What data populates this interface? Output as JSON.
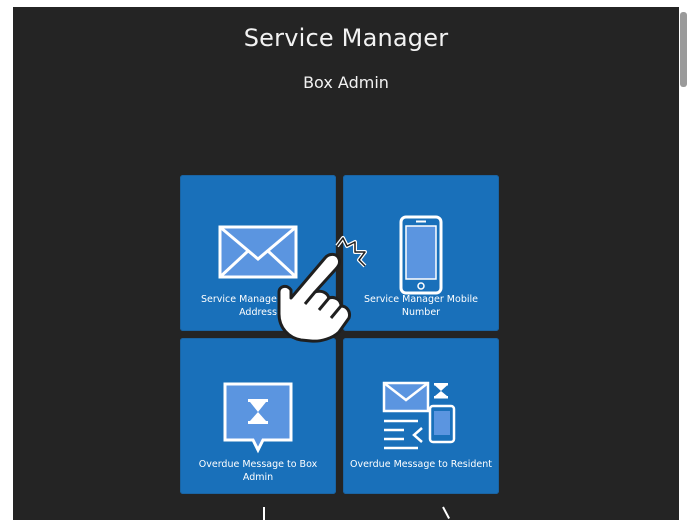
{
  "header": {
    "title": "Service Manager",
    "subtitle": "Box Admin"
  },
  "tiles": [
    {
      "label": "Service Manager Mobile Address",
      "icon": "envelope-icon"
    },
    {
      "label": "Service Manager Mobile Number",
      "icon": "mobile-phone-icon"
    },
    {
      "label": "Overdue Message to Box Admin",
      "icon": "hourglass-speech-bubble-icon"
    },
    {
      "label": "Overdue Message to Resident",
      "icon": "envelope-hourglass-phone-icon"
    }
  ],
  "overlay": {
    "icon": "tap-hand-icon"
  },
  "colors": {
    "background": "#242424",
    "tile": "#1970ba",
    "text": "#f2f2f2"
  }
}
